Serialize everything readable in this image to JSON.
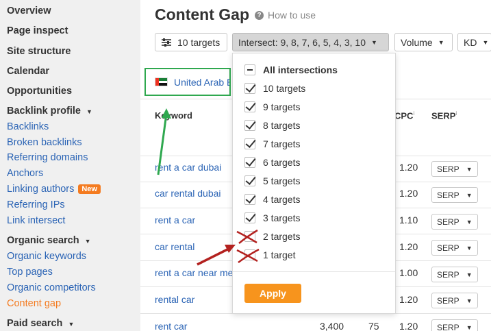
{
  "sidebar": {
    "items": [
      {
        "label": "Overview"
      },
      {
        "label": "Page inspect"
      },
      {
        "label": "Site structure"
      },
      {
        "label": "Calendar"
      },
      {
        "label": "Opportunities"
      }
    ],
    "backlink_profile": {
      "label": "Backlink profile",
      "links": [
        "Backlinks",
        "Broken backlinks",
        "Referring domains",
        "Anchors",
        "Linking authors",
        "Referring IPs",
        "Link intersect"
      ],
      "new_badge": "New"
    },
    "organic_search": {
      "label": "Organic search",
      "links": [
        "Organic keywords",
        "Top pages",
        "Organic competitors",
        "Content gap"
      ],
      "active": "Content gap"
    },
    "paid_search": {
      "label": "Paid search"
    }
  },
  "header": {
    "title": "Content Gap",
    "how_to_use": "How to use"
  },
  "toolbar": {
    "targets": "10 targets",
    "intersect": "Intersect: 9, 8, 7, 6, 5, 4, 3, 10",
    "volume": "Volume",
    "kd": "KD"
  },
  "country": {
    "name": "United Arab Emirates",
    "visible_name": "United Arab E"
  },
  "table": {
    "columns": {
      "keyword": "Keyword",
      "cpc": "CPC",
      "serp": "SERP",
      "info": "i"
    },
    "rows": [
      {
        "keyword": "rent a car dubai",
        "cpc": "1.20",
        "serp": "SERP"
      },
      {
        "keyword": "car rental dubai",
        "cpc": "1.20",
        "serp": "SERP"
      },
      {
        "keyword": "rent a car",
        "cpc": "1.10",
        "serp": "SERP"
      },
      {
        "keyword": "car rental",
        "cpc": "1.20",
        "serp": "SERP"
      },
      {
        "keyword": "rent a car near me",
        "visible_keyword": "rent a car near me",
        "cpc": "1.00",
        "serp": "SERP"
      },
      {
        "keyword": "rental car",
        "cpc": "1.20",
        "serp": "SERP"
      },
      {
        "keyword": "rent car",
        "volume": "3,400",
        "kd": "75",
        "cpc": "1.20",
        "serp": "SERP"
      }
    ]
  },
  "dropdown": {
    "all_label": "All intersections",
    "options": [
      {
        "label": "10 targets",
        "checked": true
      },
      {
        "label": "9 targets",
        "checked": true
      },
      {
        "label": "8 targets",
        "checked": true
      },
      {
        "label": "7 targets",
        "checked": true
      },
      {
        "label": "6 targets",
        "checked": true
      },
      {
        "label": "5 targets",
        "checked": true
      },
      {
        "label": "4 targets",
        "checked": true
      },
      {
        "label": "3 targets",
        "checked": true
      },
      {
        "label": "2 targets",
        "checked": false
      },
      {
        "label": "1 target",
        "checked": false
      }
    ],
    "apply": "Apply"
  },
  "colors": {
    "accent": "#f7941d",
    "link": "#2b64b5",
    "annotation_green": "#2fa84f",
    "annotation_red": "#b3211f"
  }
}
